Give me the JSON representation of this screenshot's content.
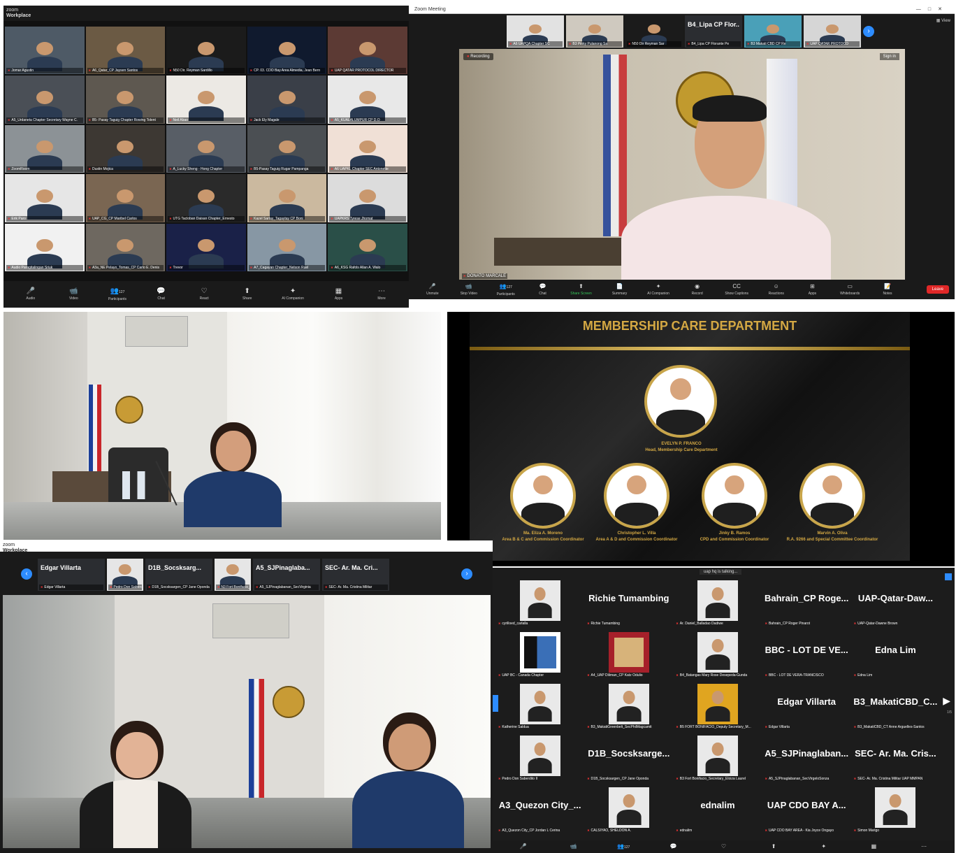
{
  "panel1": {
    "titlebar": [
      "zoom",
      "Workplace"
    ],
    "tiles": [
      "Jomar Agustin",
      "A6_Qatar_CP Jaysen Santos",
      "N50 Dir. Reyman Sardillo",
      "CP. 03. CDO Bay Area Almedia, Jean Bern",
      "UAP QATAR PROTOCOL DIRECTOR",
      "A5_Urdaneta Chapter Secretary Wayne C.",
      "B5- Pasay Taguig Chapter Rowing Tolent",
      "Neil Abao",
      "Jack Ely Magale",
      "A5_KUALALUMPUR CP D.O",
      "ZoomRoom",
      "Dustin Mojica",
      "A_Lucky Sheng - Hong Chapter",
      "B5-Pasay Taguig Rugar Pampanga",
      "A6 UAPKL Chapter SEC Antonette",
      "Erik Paro",
      "UAP_CG_CP Maribel Carlos",
      "UTG Tacloban Daisan Chapter_Ernesto",
      "Kazel Sarlay_Tagaytay CP Boni",
      "UAPKRS Tyrese Jhomat",
      "Audio Paragitalingan Sriuk",
      "A3a_NE Pelayo_Tomas_CP Carlo E. Denis",
      "Trevor",
      "A7_Cagayan Chapter_Nelson Ruel",
      "A6_KSG Rafols Allan A. Walo"
    ],
    "controls": [
      "Audio",
      "Video",
      "Participants",
      "Chat",
      "React",
      "Share",
      "AI Companion",
      "Apps",
      "More"
    ],
    "participant_count": "127"
  },
  "panel2": {
    "titlebar": "Zoom Meeting",
    "window_buttons": [
      "—",
      "□",
      "✕"
    ],
    "view_label": "View",
    "strip": [
      {
        "name": "A6 UAPQA Chapter SC"
      },
      {
        "name": "B3 Pinky Pulanong Sa"
      },
      {
        "name": "N50 Dir Reyman Sar"
      },
      {
        "name": "B4_Lipa CP Florante Pe",
        "big": "B4_Lipa CP Flor..."
      },
      {
        "name": "B3 Makati CBD CP Re"
      },
      {
        "name": "UAP QATAR PROTOCO"
      }
    ],
    "recording": "Recording",
    "sign_in": "Sign in",
    "speaker": "DONATO MARCALE",
    "controls": [
      "Unmute",
      "Stop Video",
      "Participants",
      "Chat",
      "Share Screen",
      "Summary",
      "AI Companion",
      "Record",
      "Show Captions",
      "Reactions",
      "Apps",
      "Whiteboards",
      "Notes"
    ],
    "participant_count": "127",
    "leave": "Leave"
  },
  "panel4": {
    "title": "MEMBERSHIP CARE DEPARTMENT",
    "head": {
      "name": "EVELYN P. FRANCO",
      "role": "Head, Membership Care Department"
    },
    "members": [
      {
        "name": "Ma. Eliza A. Moreno",
        "role": "Area B & C and Commission Coordinator"
      },
      {
        "name": "Christopher L. Villa",
        "role": "Area A & D and Commission Coordinator"
      },
      {
        "name": "Jinky B. Ramos",
        "role": "CPD and Commission Coordinator"
      },
      {
        "name": "Marvin A. Oliva",
        "role": "R.A. 9266 and Special Committee Coordinator"
      }
    ]
  },
  "panel5": {
    "titlebar": [
      "zoom",
      "Workplace"
    ],
    "strip": [
      {
        "big": "Edgar Villarta",
        "name": "Edgar Villarta"
      },
      {
        "name": "Pedro Don Saberdito II"
      },
      {
        "big": "D1B_Socsksarg...",
        "name": "D1B_Socsksargen_CP Jane Oponda"
      },
      {
        "name": "N3 Fort Bonifacio_Secretary"
      },
      {
        "big": "A5_SJPinaglaba...",
        "name": "A5_SJPinaglabanan_SecVirginia"
      },
      {
        "big": "SEC- Ar. Ma. Cri...",
        "name": "SEC- Ar. Ma. Cristina Militar"
      }
    ]
  },
  "panel6": {
    "talking": "uap hq is talking...",
    "tiles": [
      {
        "name": "cyrilloed_carlalla",
        "type": "photo"
      },
      {
        "big": "Richie Tumambing",
        "name": "Richie Tumambing"
      },
      {
        "name": "Ar. Daniel_Balladao Dadiwe",
        "type": "photo"
      },
      {
        "big": "Bahrain_CP Roge...",
        "name": "Bahrain_CP Roger Pinarot"
      },
      {
        "big": "UAP-Qatar-Daw...",
        "name": "UAP-Qatar-Dawne Brown"
      },
      {
        "name": "UAP BC - Canada Chapter",
        "type": "logo"
      },
      {
        "name": "A4_UAP Diliman_CP Katz Odulio",
        "type": "logo2"
      },
      {
        "name": "B4_Batangas Mary Rose Desepeda-Gunda",
        "type": "photo"
      },
      {
        "big": "BBC - LOT DE VE...",
        "name": "BBC - LOT DE VERA-TRANCISCO"
      },
      {
        "big": "Edna Lim",
        "name": "Edna Lim"
      },
      {
        "name": "Katherine Saldua",
        "type": "photo"
      },
      {
        "name": "B3_MakatiGreenbelt_SecPhilMagcamit",
        "type": "photo"
      },
      {
        "name": "B5 FORT BONIFACIO_Deputy Secretary_M...",
        "type": "photo2"
      },
      {
        "big": "Edgar Villarta",
        "name": "Edgar Villarta"
      },
      {
        "big": "B3_MakatiCBD_C...",
        "name": "B3_MakatiCBD_CT Anne Arguelles-Santos"
      },
      {
        "name": "Pedro Don Saberdito II",
        "type": "photo"
      },
      {
        "big": "D1B_Socsksarge...",
        "name": "D1B_Socsksargen_CP Jane Oponda"
      },
      {
        "name": "B3 Fort Bonifacio_Secretary_Eloiza Laurel",
        "type": "photo"
      },
      {
        "big": "A5_SJPinaglaban...",
        "name": "A5_SJPinaglabanan_SecVirgeloSonza"
      },
      {
        "big": "SEC- Ar. Ma. Cris...",
        "name": "SEC- Ar. Ma. Cristina Militar UAP MMPAN"
      },
      {
        "big": "A3_Quezon City_...",
        "name": "A3_Quezon City_CP Jordan L Cerina"
      },
      {
        "name": "CALSIYAO, SHELDON A.",
        "type": "photo"
      },
      {
        "big": "ednalim",
        "name": "ednalim"
      },
      {
        "big": "UAP CDO BAY A...",
        "name": "UAP CDO BAY AREA - Kia Joyce Ongayo"
      },
      {
        "name": "Simon Marigo",
        "type": "photo"
      }
    ],
    "page": "1/5",
    "participant_count": "127"
  },
  "colors": {
    "accent": "#2d8cff",
    "leave": "#e02828",
    "gold": "#d4a843"
  }
}
